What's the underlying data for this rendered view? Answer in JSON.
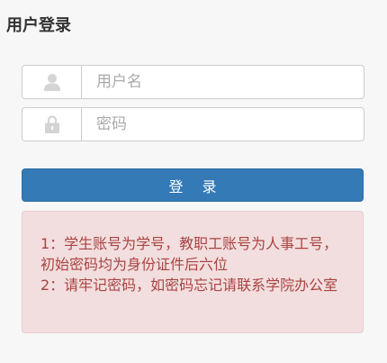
{
  "header": {
    "title": "用户登录"
  },
  "form": {
    "username": {
      "icon": "user-icon",
      "placeholder": "用户名",
      "value": ""
    },
    "password": {
      "icon": "lock-icon",
      "placeholder": "密码",
      "value": ""
    },
    "login_label": "登 录"
  },
  "notice": {
    "line1": "1：学生账号为学号，教职工账号为人事工号，初始密码均为身份证件后六位",
    "line2": "2：请牢记密码，如密码忘记请联系学院办公室"
  },
  "colors": {
    "primary": "#337ab7",
    "alert_bg": "#f2dede",
    "alert_text": "#a94442"
  }
}
